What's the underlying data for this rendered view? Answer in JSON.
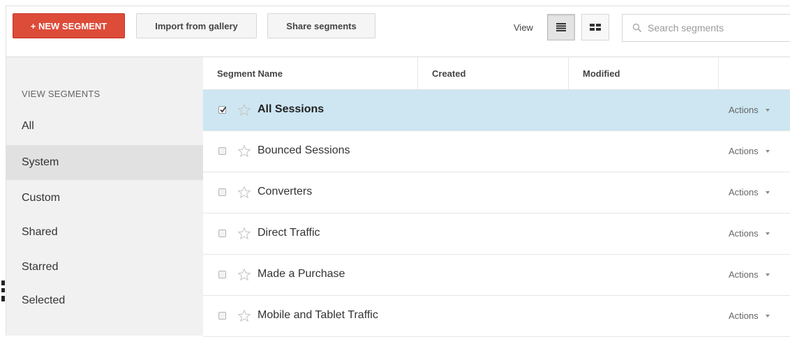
{
  "toolbar": {
    "new_segment_label": "+ NEW SEGMENT",
    "import_label": "Import from gallery",
    "share_label": "Share segments",
    "view_label": "View",
    "view_modes": [
      "list-view-icon",
      "grid-view-icon"
    ],
    "search_placeholder": "Search segments",
    "search_value": ""
  },
  "sidebar": {
    "heading": "VIEW SEGMENTS",
    "items": [
      {
        "label": "All"
      },
      {
        "label": "System"
      },
      {
        "label": "Custom"
      },
      {
        "label": "Shared"
      },
      {
        "label": "Starred"
      },
      {
        "label": "Selected"
      }
    ],
    "active": "System"
  },
  "table": {
    "headers": {
      "name": "Segment Name",
      "created": "Created",
      "modified": "Modified",
      "actions": ""
    },
    "rows": [
      {
        "name": "All Sessions",
        "checked": true,
        "starred": false,
        "created": "",
        "modified": "",
        "action_label": "Actions"
      },
      {
        "name": "Bounced Sessions",
        "checked": false,
        "starred": false,
        "created": "",
        "modified": "",
        "action_label": "Actions"
      },
      {
        "name": "Converters",
        "checked": false,
        "starred": false,
        "created": "",
        "modified": "",
        "action_label": "Actions"
      },
      {
        "name": "Direct Traffic",
        "checked": false,
        "starred": false,
        "created": "",
        "modified": "",
        "action_label": "Actions"
      },
      {
        "name": "Made a Purchase",
        "checked": false,
        "starred": false,
        "created": "",
        "modified": "",
        "action_label": "Actions"
      },
      {
        "name": "Mobile and Tablet Traffic",
        "checked": false,
        "starred": false,
        "created": "",
        "modified": "",
        "action_label": "Actions"
      }
    ]
  },
  "colors": {
    "accent_red": "#dd4b39",
    "selected_row": "#cde6f2",
    "sidebar_bg": "#f1f1f1",
    "sidebar_active": "#e1e1e1"
  }
}
